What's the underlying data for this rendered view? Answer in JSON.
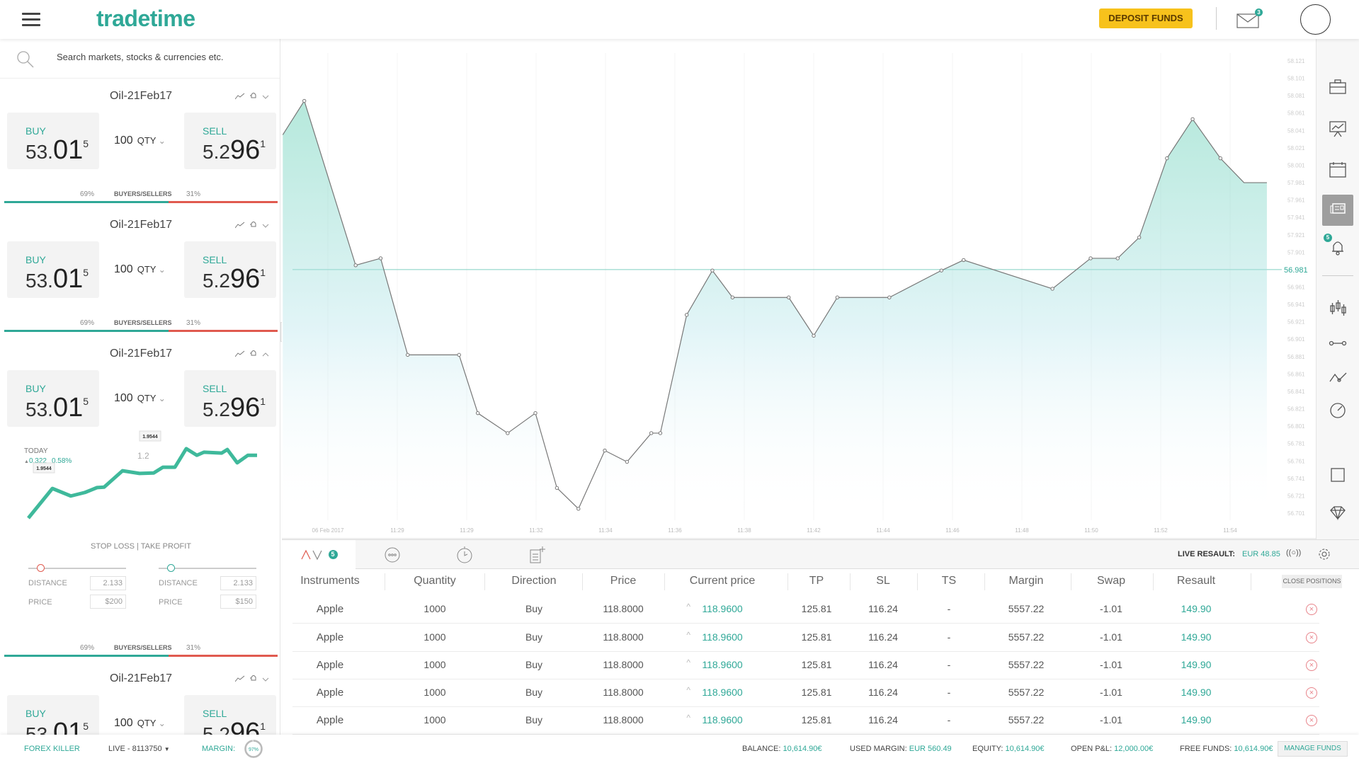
{
  "header": {
    "logo": "tradetime",
    "deposit_label": "DEPOSIT FUNDS",
    "mail_badge": "3"
  },
  "search": {
    "placeholder": "Search markets, stocks & currencies etc."
  },
  "cards": [
    {
      "title": "Oil-21Feb17",
      "buy_label": "BUY",
      "buy_main": "53.",
      "buy_big": "01",
      "buy_sup": "5",
      "qty": "100",
      "qty_unit": "QTY",
      "sell_label": "SELL",
      "sell_main": "5.2",
      "sell_big": "96",
      "sell_sup": "1",
      "buyers_pct": "69%",
      "bs_label": "BUYERS/SELLERS",
      "sellers_pct": "31%",
      "buyers_fraction": 0.6,
      "expanded": false
    },
    {
      "title": "Oil-21Feb17",
      "buy_label": "BUY",
      "buy_main": "53.",
      "buy_big": "01",
      "buy_sup": "5",
      "qty": "100",
      "qty_unit": "QTY",
      "sell_label": "SELL",
      "sell_main": "5.2",
      "sell_big": "96",
      "sell_sup": "1",
      "buyers_pct": "69%",
      "bs_label": "BUYERS/SELLERS",
      "sellers_pct": "31%",
      "buyers_fraction": 0.6,
      "expanded": false
    },
    {
      "title": "Oil-21Feb17",
      "buy_label": "BUY",
      "buy_main": "53.",
      "buy_big": "01",
      "buy_sup": "5",
      "qty": "100",
      "qty_unit": "QTY",
      "sell_label": "SELL",
      "sell_main": "5.2",
      "sell_big": "96",
      "sell_sup": "1",
      "buyers_pct": "69%",
      "bs_label": "BUYERS/SELLERS",
      "sellers_pct": "31%",
      "buyers_fraction": 0.6,
      "expanded": true
    },
    {
      "title": "Oil-21Feb17",
      "buy_label": "BUY",
      "buy_main": "53.",
      "buy_big": "01",
      "buy_sup": "5",
      "qty": "100",
      "qty_unit": "QTY",
      "sell_label": "SELL",
      "sell_main": "5.2",
      "sell_big": "96",
      "sell_sup": "1",
      "buyers_pct": "69%",
      "bs_label": "BUYERS/SELLERS",
      "sellers_pct": "31%",
      "buyers_fraction": 0.6,
      "expanded": false
    }
  ],
  "detail": {
    "today_label": "TODAY",
    "change": "0.322",
    "change_pct": "0.58%",
    "mid_label": "1.2",
    "tooltip_low": "1.9544",
    "tooltip_high": "1.9544",
    "sparkline": [
      1.8,
      1.867,
      1.85,
      1.858,
      1.869,
      1.87,
      1.907,
      1.901,
      1.902,
      1.915,
      1.915,
      1.957,
      1.942,
      1.949,
      1.947,
      1.955,
      1.925,
      1.942,
      1.942
    ],
    "sltp_title": "STOP LOSS | TAKE PROFIT",
    "sl": {
      "distance_label": "DISTANCE",
      "distance": "2.133",
      "price_label": "PRICE",
      "price": "$200",
      "slider": 0.12
    },
    "tp": {
      "distance_label": "DISTANCE",
      "distance": "2.133",
      "price_label": "PRICE",
      "price": "$150",
      "slider": 0.12
    }
  },
  "chart_data": {
    "type": "area",
    "x_labels": [
      "06 Feb 2017",
      "11:29",
      "11:29",
      "11:32",
      "11:34",
      "11:36",
      "11:38",
      "11:42",
      "11:44",
      "11:46",
      "11:48",
      "11:50",
      "11:52",
      "11:54"
    ],
    "y_labels": [
      "58.121",
      "58.101",
      "58.081",
      "58.061",
      "58.041",
      "58.021",
      "58.001",
      "57.981",
      "57.961",
      "57.941",
      "57.921",
      "57.901",
      "56.981",
      "56.961",
      "56.941",
      "56.921",
      "56.901",
      "56.881",
      "56.861",
      "56.841",
      "56.821",
      "56.801",
      "56.781",
      "56.761",
      "56.741",
      "56.721",
      "56.701"
    ],
    "current_value": "56.981",
    "points_x": [
      -0.65,
      -0.34,
      0.4,
      0.76,
      1.15,
      1.89,
      2.16,
      2.59,
      2.99,
      3.3,
      3.61,
      3.99,
      4.31,
      4.66,
      4.79,
      5.17,
      5.54,
      5.83,
      6.64,
      7.0,
      7.34,
      8.09,
      8.84,
      9.16,
      10.44,
      10.99,
      11.38,
      11.69,
      12.09,
      12.46,
      12.86,
      13.2,
      13.53
    ],
    "points_y": [
      58.036,
      58.075,
      57.211,
      57.579,
      56.883,
      56.883,
      56.816,
      56.793,
      56.816,
      56.73,
      56.706,
      56.773,
      56.76,
      56.793,
      56.793,
      56.929,
      56.98,
      56.949,
      56.949,
      56.905,
      56.949,
      56.949,
      56.98,
      57.487,
      56.959,
      57.579,
      57.579,
      57.918,
      58.009,
      58.054,
      58.009,
      57.981,
      57.981
    ],
    "color": "#2fa897"
  },
  "tabs": {
    "active_badge": "5",
    "live_label": "LIVE RESAULT:",
    "live_value": "EUR 48.85"
  },
  "table": {
    "headers": [
      "Instruments",
      "Quantity",
      "Direction",
      "Price",
      "Current price",
      "TP",
      "SL",
      "TS",
      "Margin",
      "Swap",
      "Resault"
    ],
    "close_label": "CLOSE POSITIONS",
    "rows": [
      [
        "Apple",
        "1000",
        "Buy",
        "118.8000",
        "118.9600",
        "125.81",
        "116.24",
        "-",
        "5557.22",
        "-1.01",
        "149.90"
      ],
      [
        "Apple",
        "1000",
        "Buy",
        "118.8000",
        "118.9600",
        "125.81",
        "116.24",
        "-",
        "5557.22",
        "-1.01",
        "149.90"
      ],
      [
        "Apple",
        "1000",
        "Buy",
        "118.8000",
        "118.9600",
        "125.81",
        "116.24",
        "-",
        "5557.22",
        "-1.01",
        "149.90"
      ],
      [
        "Apple",
        "1000",
        "Buy",
        "118.8000",
        "118.9600",
        "125.81",
        "116.24",
        "-",
        "5557.22",
        "-1.01",
        "149.90"
      ],
      [
        "Apple",
        "1000",
        "Buy",
        "118.8000",
        "118.9600",
        "125.81",
        "116.24",
        "-",
        "5557.22",
        "-1.01",
        "149.90"
      ]
    ]
  },
  "footer": {
    "account_name": "FOREX KILLER",
    "account": "LIVE - 8113750",
    "margin_label": "MARGIN:",
    "margin_pct": "97%",
    "margin_fraction": 0.97,
    "balance_label": "BALANCE:",
    "balance": "10,614.90€",
    "used_margin_label": "USED MARGIN:",
    "used_margin": "EUR 560.49",
    "equity_label": "EQUITY:",
    "equity": "10,614.90€",
    "open_pl_label": "OPEN P&L:",
    "open_pl": "12,000.00€",
    "free_funds_label": "FREE FUNDS:",
    "free_funds": "10,614.90€",
    "manage_label": "MANAGE FUNDS"
  },
  "colors": {
    "teal": "#2fa897",
    "red": "#e05a4f",
    "yellow": "#f7c21c"
  }
}
